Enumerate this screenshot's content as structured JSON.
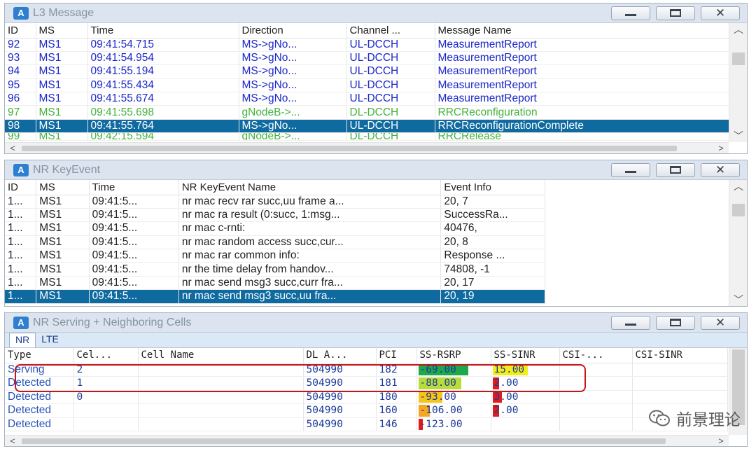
{
  "l3": {
    "title": "L3 Message",
    "columns": [
      "ID",
      "MS",
      "Time",
      "Direction",
      "Channel ...",
      "Message Name"
    ],
    "rows": [
      {
        "id": "92",
        "ms": "MS1",
        "time": "09:41:54.715",
        "dir": "MS->gNo...",
        "ch": "UL-DCCH",
        "msg": "MeasurementReport",
        "color": "blue"
      },
      {
        "id": "93",
        "ms": "MS1",
        "time": "09:41:54.954",
        "dir": "MS->gNo...",
        "ch": "UL-DCCH",
        "msg": "MeasurementReport",
        "color": "blue"
      },
      {
        "id": "94",
        "ms": "MS1",
        "time": "09:41:55.194",
        "dir": "MS->gNo...",
        "ch": "UL-DCCH",
        "msg": "MeasurementReport",
        "color": "blue"
      },
      {
        "id": "95",
        "ms": "MS1",
        "time": "09:41:55.434",
        "dir": "MS->gNo...",
        "ch": "UL-DCCH",
        "msg": "MeasurementReport",
        "color": "blue"
      },
      {
        "id": "96",
        "ms": "MS1",
        "time": "09:41:55.674",
        "dir": "MS->gNo...",
        "ch": "UL-DCCH",
        "msg": "MeasurementReport",
        "color": "blue"
      },
      {
        "id": "97",
        "ms": "MS1",
        "time": "09:41:55.698",
        "dir": "gNodeB->...",
        "ch": "DL-DCCH",
        "msg": "RRCReconfiguration",
        "color": "green"
      },
      {
        "id": "98",
        "ms": "MS1",
        "time": "09:41:55.764",
        "dir": "MS->gNo...",
        "ch": "UL-DCCH",
        "msg": "RRCReconfigurationComplete",
        "color": "selected"
      },
      {
        "id": "99",
        "ms": "MS1",
        "time": "09:42:15.594",
        "dir": "gNodeB->...",
        "ch": "DL-DCCH",
        "msg": "RRCRelease",
        "color": "green-partial"
      }
    ]
  },
  "keyevent": {
    "title": "NR KeyEvent",
    "columns": [
      "ID",
      "MS",
      "Time",
      "NR KeyEvent Name",
      "Event Info"
    ],
    "rows": [
      {
        "id": "1...",
        "ms": "MS1",
        "time": "09:41:5...",
        "name": "nr mac recv rar succ,uu frame a...",
        "info": "20, 7",
        "selected": false
      },
      {
        "id": "1...",
        "ms": "MS1",
        "time": "09:41:5...",
        "name": "nr mac ra result (0:succ, 1:msg...",
        "info": "SuccessRa...",
        "selected": false
      },
      {
        "id": "1...",
        "ms": "MS1",
        "time": "09:41:5...",
        "name": "nr mac c-rnti:",
        "info": "40476,",
        "selected": false
      },
      {
        "id": "1...",
        "ms": "MS1",
        "time": "09:41:5...",
        "name": "nr mac random access succ,cur...",
        "info": "20, 8",
        "selected": false
      },
      {
        "id": "1...",
        "ms": "MS1",
        "time": "09:41:5...",
        "name": "nr mac rar common info:",
        "info": "Response ...",
        "selected": false
      },
      {
        "id": "1...",
        "ms": "MS1",
        "time": "09:41:5...",
        "name": "nr the time delay from handov...",
        "info": "74808, -1",
        "selected": false
      },
      {
        "id": "1...",
        "ms": "MS1",
        "time": "09:41:5...",
        "name": "nr mac send msg3 succ,curr fra...",
        "info": "20, 17",
        "selected": false
      },
      {
        "id": "1...",
        "ms": "MS1",
        "time": "09:41:5...",
        "name": "nr mac send msg3 succ,uu fra...",
        "info": "20, 19",
        "selected": true
      }
    ]
  },
  "cells": {
    "title": "NR Serving + Neighboring Cells",
    "tabs": [
      "NR",
      "LTE"
    ],
    "columns": [
      "Type",
      "Cel...",
      "Cell Name",
      "DL A...",
      "PCI",
      "SS-RSRP",
      "SS-SINR",
      "CSI-...",
      "CSI-SINR"
    ],
    "rows": [
      {
        "type": "Serving",
        "cel": "2",
        "name": "",
        "dla": "504990",
        "pci": "182",
        "rsrp": "-69.00",
        "sinr": "15.00",
        "rsrp_fill": 0.72,
        "rsrp_color": "#1fa84a",
        "sinr_fill": 0.55,
        "sinr_color": "#f2ee1c"
      },
      {
        "type": "Detected",
        "cel": "1",
        "name": "",
        "dla": "504990",
        "pci": "181",
        "rsrp": "-88.00",
        "sinr": "2.00",
        "rsrp_fill": 0.62,
        "rsrp_color": "#b8dc3c",
        "sinr_fill": 0.1,
        "sinr_color": "#e11b1b"
      },
      {
        "type": "Detected",
        "cel": "0",
        "name": "",
        "dla": "504990",
        "pci": "180",
        "rsrp": "-93.00",
        "sinr": "3.00",
        "rsrp_fill": 0.35,
        "rsrp_color": "#f5c518",
        "sinr_fill": 0.14,
        "sinr_color": "#e11b1b"
      },
      {
        "type": "Detected",
        "cel": "",
        "name": "",
        "dla": "504990",
        "pci": "160",
        "rsrp": "-106.00",
        "sinr": "2.00",
        "rsrp_fill": 0.16,
        "rsrp_color": "#f5a623",
        "sinr_fill": 0.1,
        "sinr_color": "#e11b1b"
      },
      {
        "type": "Detected",
        "cel": "",
        "name": "",
        "dla": "504990",
        "pci": "146",
        "rsrp": "-123.00",
        "sinr": "",
        "rsrp_fill": 0.06,
        "rsrp_color": "#e11b1b",
        "sinr_fill": 0,
        "sinr_color": "#e11b1b"
      }
    ]
  },
  "watermark": {
    "text": "前景理论"
  }
}
